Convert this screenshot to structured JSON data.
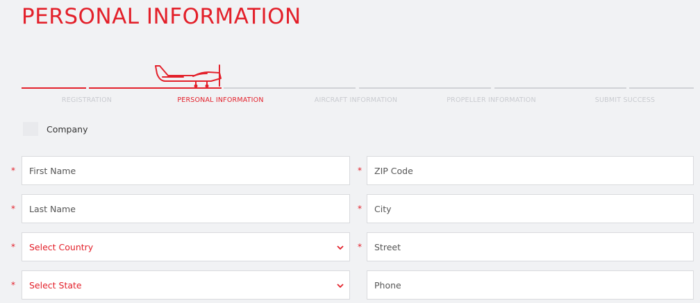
{
  "page_title": "PERSONAL INFORMATION",
  "colors": {
    "accent": "#e3202a",
    "inactive": "#d0d2d6",
    "background": "#f1f2f4"
  },
  "steps": [
    {
      "label": "REGISTRATION",
      "state": "done"
    },
    {
      "label": "PERSONAL INFORMATION",
      "state": "active"
    },
    {
      "label": "AIRCRAFT INFORMATION",
      "state": "todo"
    },
    {
      "label": "PROPELLER INFORMATION",
      "state": "todo"
    },
    {
      "label": "SUBMIT SUCCESS",
      "state": "todo"
    }
  ],
  "company_checkbox": {
    "label": "Company",
    "checked": false
  },
  "required_mark": "*",
  "left_fields": [
    {
      "placeholder": "First Name",
      "type": "text"
    },
    {
      "placeholder": "Last Name",
      "type": "text"
    },
    {
      "placeholder": "Select Country",
      "type": "select"
    },
    {
      "placeholder": "Select State",
      "type": "select"
    }
  ],
  "right_fields": [
    {
      "placeholder": "ZIP Code",
      "type": "text",
      "required": true
    },
    {
      "placeholder": "City",
      "type": "text",
      "required": true
    },
    {
      "placeholder": "Street",
      "type": "text",
      "required": true
    },
    {
      "placeholder": "Phone",
      "type": "text",
      "required": false
    }
  ],
  "icons": {
    "progress_marker": "airplane-icon",
    "select_arrow": "chevron-down-icon"
  }
}
